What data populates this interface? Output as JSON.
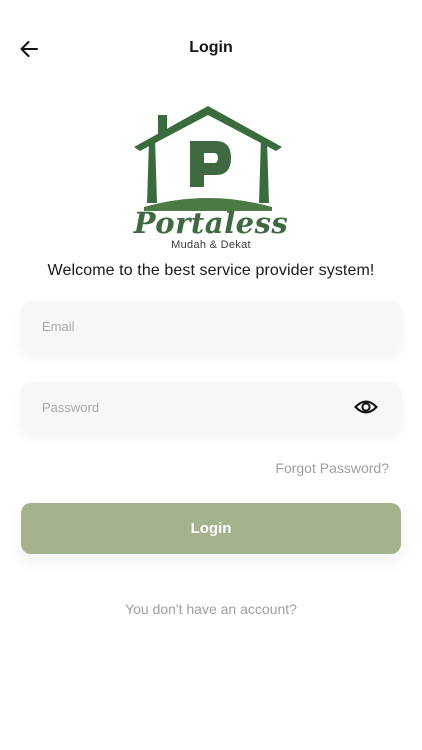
{
  "header": {
    "title": "Login",
    "back_icon": "arrow-left-icon"
  },
  "brand": {
    "name": "Portaless",
    "tagline": "Mudah & Dekat",
    "logo_letter": "P",
    "primary_color": "#3f6a41"
  },
  "welcome_text": "Welcome to the best service provider system!",
  "form": {
    "email": {
      "value": "",
      "placeholder": "Email"
    },
    "password": {
      "value": "",
      "placeholder": "Password",
      "toggle_icon": "eye-icon"
    },
    "forgot_label": "Forgot Password?",
    "submit_label": "Login",
    "submit_color": "#a4b38b"
  },
  "signup_prompt": "You don't have an account?"
}
